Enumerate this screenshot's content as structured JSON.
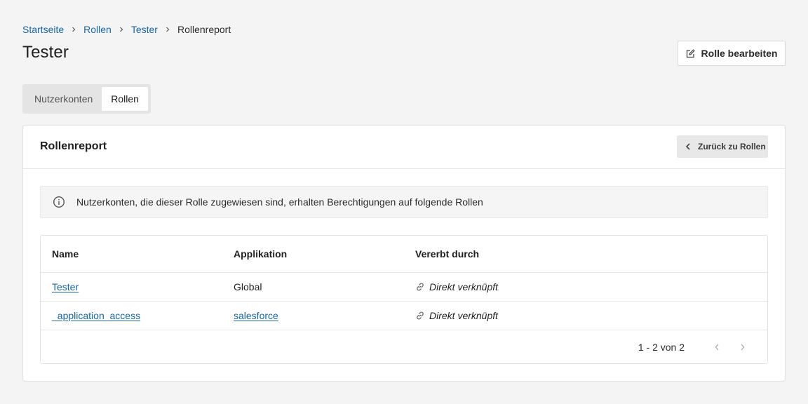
{
  "breadcrumb": [
    {
      "label": "Startseite",
      "link": true
    },
    {
      "label": "Rollen",
      "link": true
    },
    {
      "label": "Tester",
      "link": true
    },
    {
      "label": "Rollenreport",
      "link": false
    }
  ],
  "page_title": "Tester",
  "edit_button": {
    "label": "Rolle bearbeiten",
    "icon": "edit-icon"
  },
  "tabs": [
    {
      "label": "Nutzerkonten",
      "active": false
    },
    {
      "label": "Rollen",
      "active": true
    }
  ],
  "card": {
    "title": "Rollenreport",
    "back_button": {
      "label": "Zurück zu Rollen",
      "icon": "chevron-left-icon"
    },
    "info": {
      "text": "Nutzerkonten, die dieser Rolle zugewiesen sind, erhalten Berechtigungen auf folgende Rollen",
      "icon": "info-icon"
    }
  },
  "table": {
    "columns": [
      "Name",
      "Applikation",
      "Vererbt durch"
    ],
    "rows": [
      {
        "name": "Tester",
        "application": "Global",
        "application_link": false,
        "inherited": "Direkt verknüpft"
      },
      {
        "name": "_application_access",
        "application": "salesforce",
        "application_link": true,
        "inherited": "Direkt verknüpft"
      }
    ],
    "pagination": "1 - 2 von 2"
  },
  "colors": {
    "link": "#1565a8",
    "background": "#f4f4f4",
    "muted_button": "#e8e8e8"
  }
}
